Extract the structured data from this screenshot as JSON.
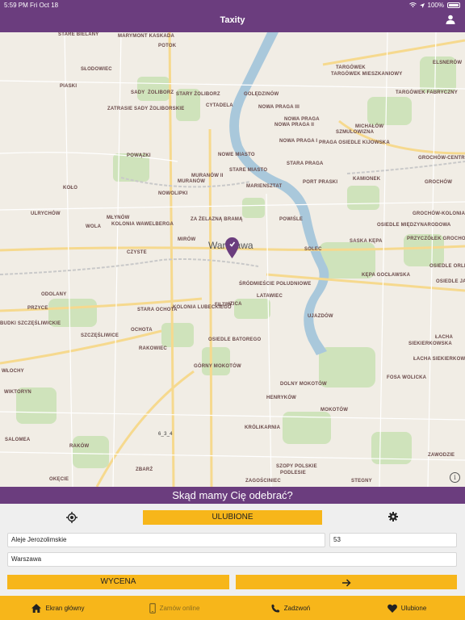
{
  "status_bar": {
    "time": "5:59 PM",
    "date": "Fri Oct 18",
    "battery": "100%"
  },
  "header": {
    "title": "Taxity",
    "user_icon": "user-icon"
  },
  "map": {
    "city_label": "Warszawa",
    "scale_text": "6_3_4",
    "marker_icon": "map-pin-icon",
    "info_icon_text": "i",
    "districts": [
      "STARE BIELANY",
      "MARYMONT KASKADA",
      "SŁODOWIEC",
      "POTOK",
      "PIASKI",
      "SADY",
      "ŻOLIBORZ",
      "STARY ŻOLIBORZ",
      "CYTADELA",
      "GOLĘDZINÓW",
      "ZATRASIE SADY ŻOLIBORSKIE",
      "NOWA PRAGA III",
      "NOWA PRAGA",
      "NOWA PRAGA II",
      "NOWA PRAGA I",
      "TARGÓWEK",
      "TARGÓWEK MIESZKANIOWY",
      "TARGÓWEK FABRYCZNY",
      "ELSNERÓW",
      "MICHAŁÓW",
      "SZMULOWIZNA",
      "PRAGA OSIEDLE KIJOWSKA",
      "POWĄZKI",
      "NOWE MIASTO",
      "STARE MIASTO",
      "MURANÓW II",
      "MURANÓW",
      "MARIENSZTAT",
      "STARA PRAGA",
      "PORT PRASKI",
      "KAMIONEK",
      "GROCHÓW-CENTRUM",
      "GROCHÓW",
      "KOŁO",
      "NOWOLIPKI",
      "ULRYCHÓW",
      "MŁYNÓW",
      "KOLONIA WAWELBERGA",
      "WOLA",
      "ZA ŻELAZNĄ BRAMĄ",
      "POWIŚLE",
      "MIRÓW",
      "CZYSTE",
      "SOLEC",
      "GROCHÓW-KOLONIA",
      "OSIEDLE MIĘDZYNARODOWA",
      "SASKA KĘPA",
      "PRZYCZÓŁEK GROCHOWSKI",
      "OSIEDLE ORLIK",
      "OSIEDLE JANTAR",
      "KĘPA GOCŁAWSKA",
      "ŚRÓDMIEŚCIE POŁUDNIOWE",
      "LATAWIEC",
      "ODOLANY",
      "PRZYCE",
      "STARA OCHOTA",
      "FILTRY",
      "KOLONIA LUBECKIEGO",
      "IZICA",
      "UJAZDÓW",
      "BUDKI SZCZĘŚLIWICKIE",
      "SZCZĘŚLIWICE",
      "OCHOTA",
      "RAKOWIEC",
      "OSIEDLE BATOREGO",
      "ŁACHA",
      "SIEKIERKOWSKA",
      "GÓRNY MOKOTÓW",
      "WŁOCHY",
      "WIKTORYN",
      "DOLNY MOKOTÓW",
      "FOSA WOLICKA",
      "HENRYKÓW",
      "MOKOTÓW",
      "KRÓLIKARNIA",
      "SALOMEA",
      "RAKÓW",
      "ZBARŻ",
      "SZOPY POLSKIE",
      "PODLESIE",
      "OKĘCIE",
      "ZAGOŚCINIEC",
      "STEGNY",
      "ZAWODZIE",
      "ŁACHA SIEKIERKOWSKA"
    ]
  },
  "prompt": {
    "text": "Skąd mamy Cię odebrać?"
  },
  "form": {
    "locate_icon": "crosshair-icon",
    "favorites_label": "ULUBIONE",
    "settings_icon": "gear-icon",
    "street_value": "Aleje Jerozolimskie",
    "number_value": "53",
    "city_value": "Warszawa",
    "price_label": "WYCENA",
    "next_icon": "arrow-right-icon"
  },
  "tabbar": {
    "items": [
      {
        "label": "Ekran główny",
        "icon": "home-icon"
      },
      {
        "label": "Zamów online",
        "icon": "phone-device-icon"
      },
      {
        "label": "Zadzwoń",
        "icon": "phone-call-icon"
      },
      {
        "label": "Ulubione",
        "icon": "heart-icon"
      }
    ]
  },
  "colors": {
    "brand_purple": "#6b3d7e",
    "accent_yellow": "#f7b61a",
    "river": "#aac9dc",
    "park": "#c9e0b4"
  }
}
